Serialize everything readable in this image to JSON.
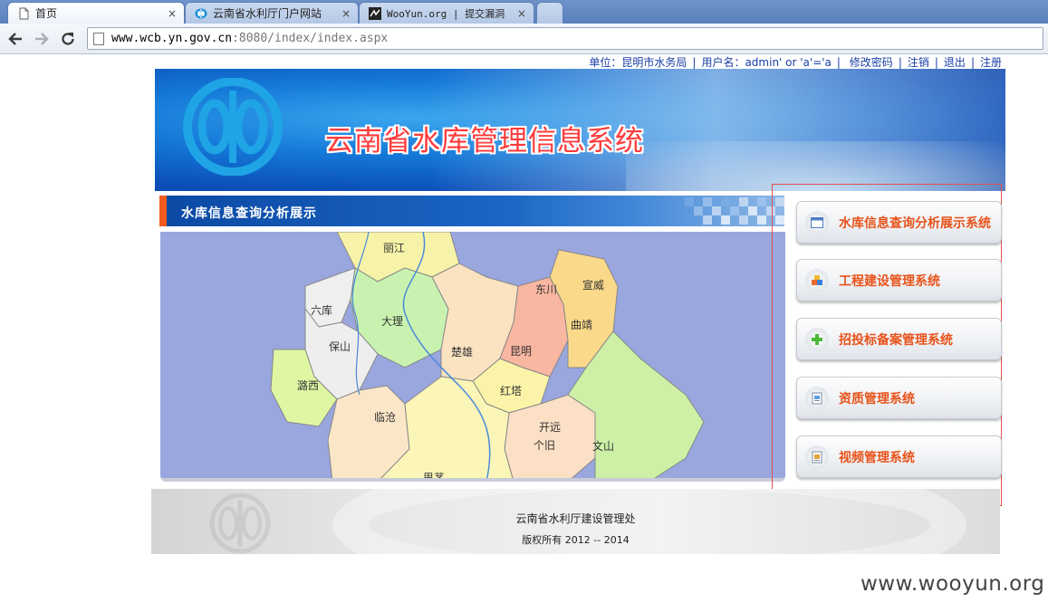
{
  "browser": {
    "tabs": [
      {
        "title": "首页",
        "icon": "page-icon",
        "active": true
      },
      {
        "title": "云南省水利厅门户网站",
        "icon": "water-logo-icon",
        "active": false
      },
      {
        "title": "WooYun.org | 提交漏洞",
        "icon": "wooyun-icon",
        "active": false
      }
    ],
    "tab_close_glyph": "×",
    "url_host": "www.wcb.yn.gov.cn",
    "url_rest": ":8080/index/index.aspx"
  },
  "userbar": {
    "unit": "单位：昆明市水务局",
    "user": "用户名：admin' or 'a'='a",
    "separator": "|",
    "links": [
      "修改密码",
      "注销",
      "退出",
      "注册"
    ]
  },
  "banner": {
    "title": "云南省水库管理信息系统"
  },
  "map_panel": {
    "title": "水库信息查询分析展示",
    "labels": [
      "丽江",
      "大理",
      "六库",
      "保山",
      "潞西",
      "临沧",
      "楚雄",
      "昆明",
      "东川",
      "宣威",
      "曲靖",
      "红塔",
      "开远",
      "个旧",
      "文山",
      "思茅"
    ]
  },
  "systems": [
    {
      "label": "水库信息查询分析展示系统",
      "icon": "window-icon"
    },
    {
      "label": "工程建设管理系统",
      "icon": "blocks-icon"
    },
    {
      "label": "招投标备案管理系统",
      "icon": "plus-icon"
    },
    {
      "label": "资质管理系统",
      "icon": "document-icon"
    },
    {
      "label": "视频管理系统",
      "icon": "video-icon"
    }
  ],
  "footer": {
    "line1": "云南省水利厅建设管理处",
    "line2": "版权所有 2012 -- 2014"
  },
  "watermark": "www.wooyun.org",
  "colors": {
    "accent_orange": "#e8531a",
    "link_blue": "#1b3fa6",
    "banner_title_red": "#ff3b3b",
    "selection_border": "#e05050"
  }
}
